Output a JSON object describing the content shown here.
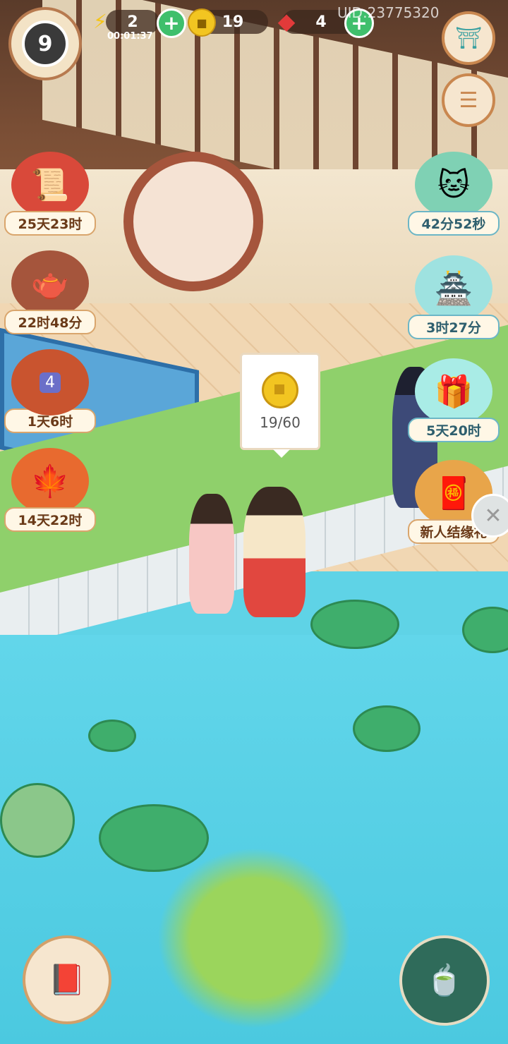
{
  "hud": {
    "level": "9",
    "energy": "2",
    "energy_timer": "00:01:37",
    "coins": "19",
    "gems": "4",
    "uid": "UID:23775320"
  },
  "events_left": [
    {
      "label": "25天23时",
      "icon": "scroll-books-icon"
    },
    {
      "label": "22时48分",
      "icon": "teapot-icon"
    },
    {
      "label": "1天6时",
      "icon": "chest-icon",
      "badge": "4"
    },
    {
      "label": "14天22时",
      "icon": "autumn-goblet-icon"
    }
  ],
  "events_right": [
    {
      "label": "42分52秒",
      "icon": "cat-treasure-cart-icon"
    },
    {
      "label": "3时27分",
      "icon": "jade-pavilion-icon"
    },
    {
      "label": "5天20时",
      "icon": "jade-cat-box-icon"
    },
    {
      "label": "新人结缘礼",
      "icon": "gift-chest-icon"
    }
  ],
  "tooltip": {
    "value": "19/60",
    "icon": "coin-icon"
  },
  "icons": {
    "shop": "lantern-icon",
    "menu": "list-icon",
    "book": "red-book-icon",
    "tea": "teapot-rabbit-icon",
    "close": "close-icon"
  },
  "colors": {
    "water": "#5fd3e6",
    "grass": "#8fd06b",
    "accent_green": "#3fbf6c"
  }
}
